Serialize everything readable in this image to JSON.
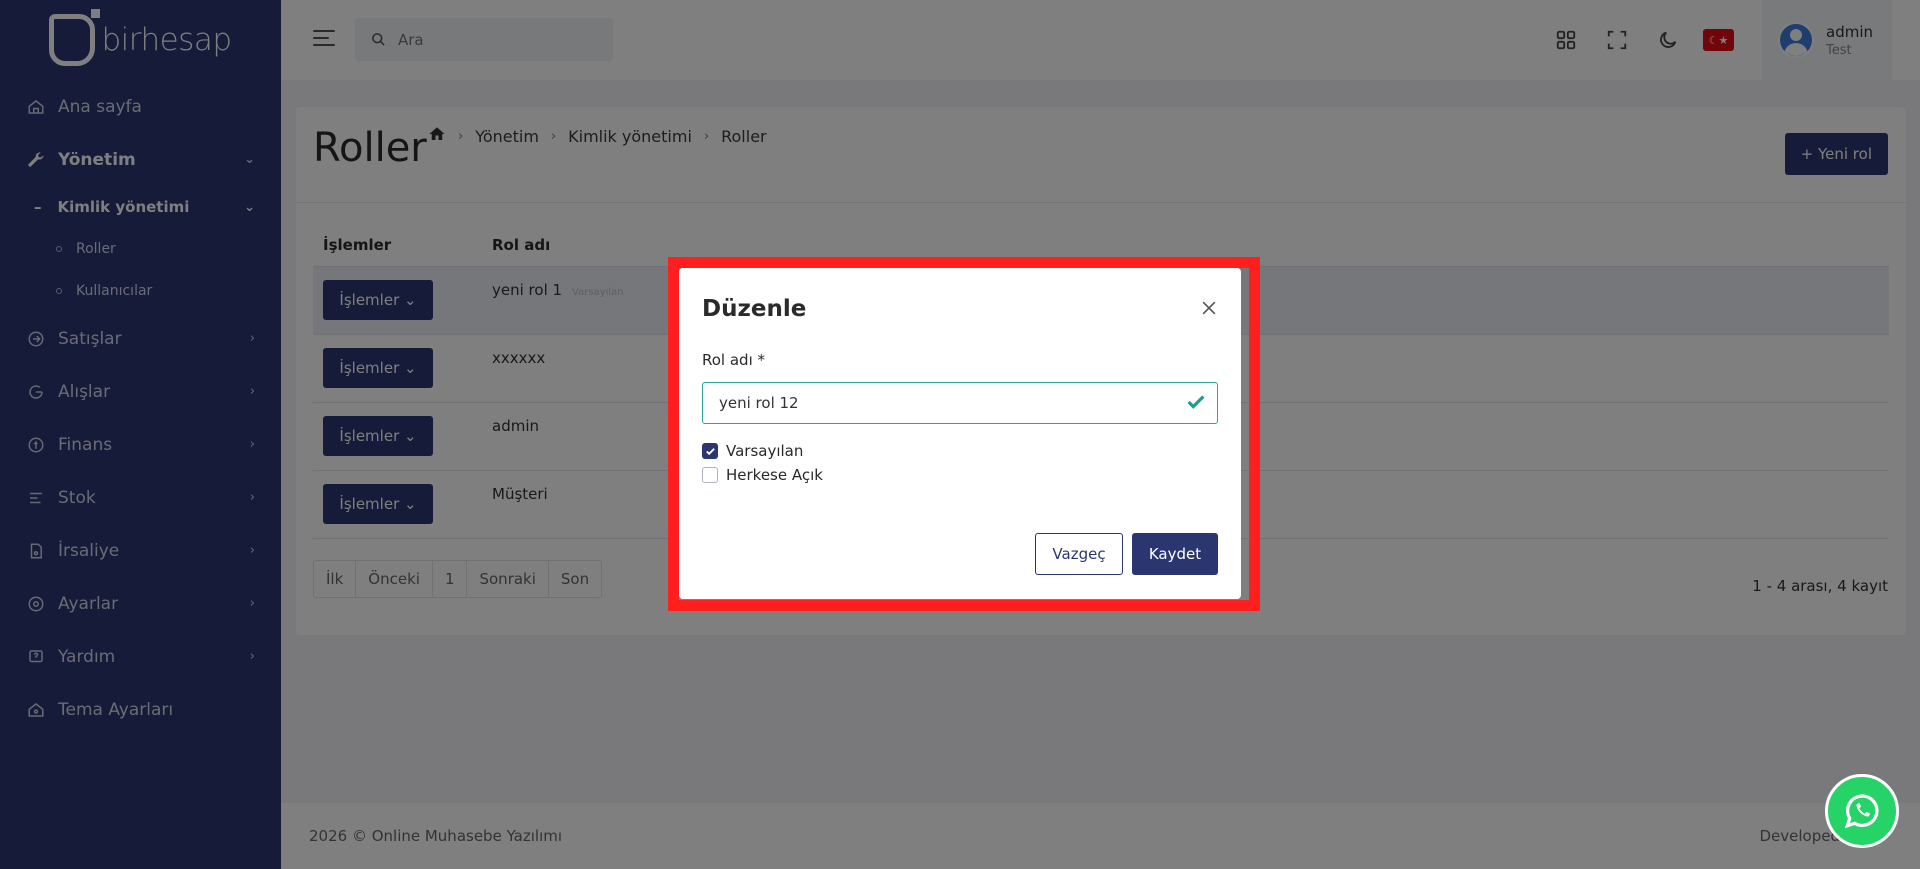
{
  "app": {
    "logo_text": "birhesap"
  },
  "sidebar": {
    "items": [
      {
        "label": "Ana sayfa",
        "icon": "home-icon"
      },
      {
        "label": "Yönetim",
        "icon": "wrench-icon"
      },
      {
        "label": "Kimlik yönetimi"
      },
      {
        "label": "Roller"
      },
      {
        "label": "Kullanıcılar"
      },
      {
        "label": "Satışlar",
        "icon": "sales-icon"
      },
      {
        "label": "Alışlar",
        "icon": "purchase-icon"
      },
      {
        "label": "Finans",
        "icon": "finance-icon"
      },
      {
        "label": "Stok",
        "icon": "stock-icon"
      },
      {
        "label": "İrsaliye",
        "icon": "waybill-icon"
      },
      {
        "label": "Ayarlar",
        "icon": "settings-icon"
      },
      {
        "label": "Yardım",
        "icon": "help-icon"
      },
      {
        "label": "Tema Ayarları",
        "icon": "theme-icon"
      }
    ]
  },
  "topbar": {
    "search_placeholder": "Ara",
    "user_name": "admin",
    "user_tenant": "Test"
  },
  "page": {
    "title": "Roller",
    "breadcrumb": [
      "Yönetim",
      "Kimlik yönetimi",
      "Roller"
    ],
    "new_button": "Yeni rol"
  },
  "table": {
    "headers": [
      "İşlemler",
      "Rol adı"
    ],
    "ops_label": "İşlemler",
    "rows": [
      {
        "name": "yeni rol 1",
        "badge": "Varsayılan"
      },
      {
        "name": "xxxxxx",
        "badge": ""
      },
      {
        "name": "admin",
        "badge": ""
      },
      {
        "name": "Müşteri",
        "badge": ""
      }
    ]
  },
  "pagination": {
    "first": "İlk",
    "prev": "Önceki",
    "current": "1",
    "next": "Sonraki",
    "last": "Son"
  },
  "record_count": "1 - 4 arası, 4 kayıt",
  "footer": {
    "left": "2026 © Online Muhasebe Yazılımı",
    "right": "Developed"
  },
  "modal": {
    "title": "Düzenle",
    "field_label": "Rol adı *",
    "field_value": "yeni rol 12",
    "checkbox_default": "Varsayılan",
    "checkbox_default_checked": true,
    "checkbox_public": "Herkese Açık",
    "checkbox_public_checked": false,
    "cancel": "Vazgeç",
    "save": "Kaydet"
  },
  "colors": {
    "primary": "#2b3671",
    "highlight": "#ff1f1f",
    "valid": "#2aa59a",
    "whatsapp": "#25d366"
  }
}
